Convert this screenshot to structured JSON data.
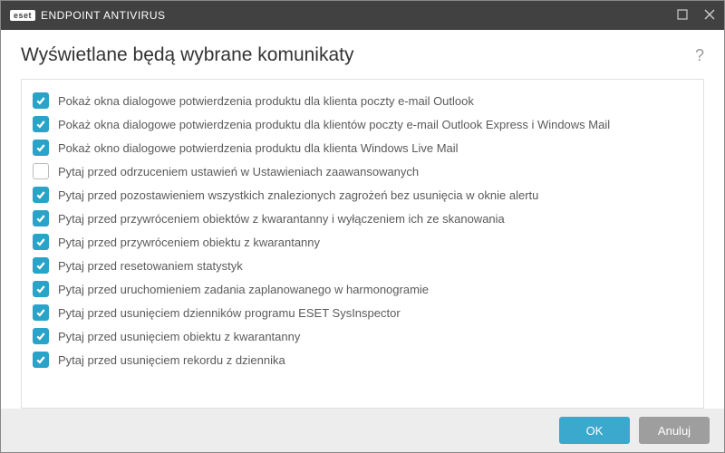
{
  "window": {
    "brand_logo": "eset",
    "product_name": "ENDPOINT ANTIVIRUS"
  },
  "page": {
    "title": "Wyświetlane będą wybrane komunikaty"
  },
  "options": [
    {
      "checked": true,
      "label": "Pokaż okna dialogowe potwierdzenia produktu dla klienta poczty e-mail Outlook"
    },
    {
      "checked": true,
      "label": "Pokaż okna dialogowe potwierdzenia produktu dla klientów poczty e-mail Outlook Express i Windows Mail"
    },
    {
      "checked": true,
      "label": "Pokaż okno dialogowe potwierdzenia produktu dla klienta Windows Live Mail"
    },
    {
      "checked": false,
      "label": "Pytaj przed odrzuceniem ustawień w Ustawieniach zaawansowanych"
    },
    {
      "checked": true,
      "label": "Pytaj przed pozostawieniem wszystkich znalezionych zagrożeń bez usunięcia w oknie alertu"
    },
    {
      "checked": true,
      "label": "Pytaj przed przywróceniem obiektów z kwarantanny i wyłączeniem ich ze skanowania"
    },
    {
      "checked": true,
      "label": "Pytaj przed przywróceniem obiektu z kwarantanny"
    },
    {
      "checked": true,
      "label": "Pytaj przed resetowaniem statystyk"
    },
    {
      "checked": true,
      "label": "Pytaj przed uruchomieniem zadania zaplanowanego w harmonogramie"
    },
    {
      "checked": true,
      "label": "Pytaj przed usunięciem dzienników programu ESET SysInspector"
    },
    {
      "checked": true,
      "label": "Pytaj przed usunięciem obiektu z kwarantanny"
    },
    {
      "checked": true,
      "label": "Pytaj przed usunięciem rekordu z dziennika"
    }
  ],
  "footer": {
    "ok_label": "OK",
    "cancel_label": "Anuluj"
  }
}
